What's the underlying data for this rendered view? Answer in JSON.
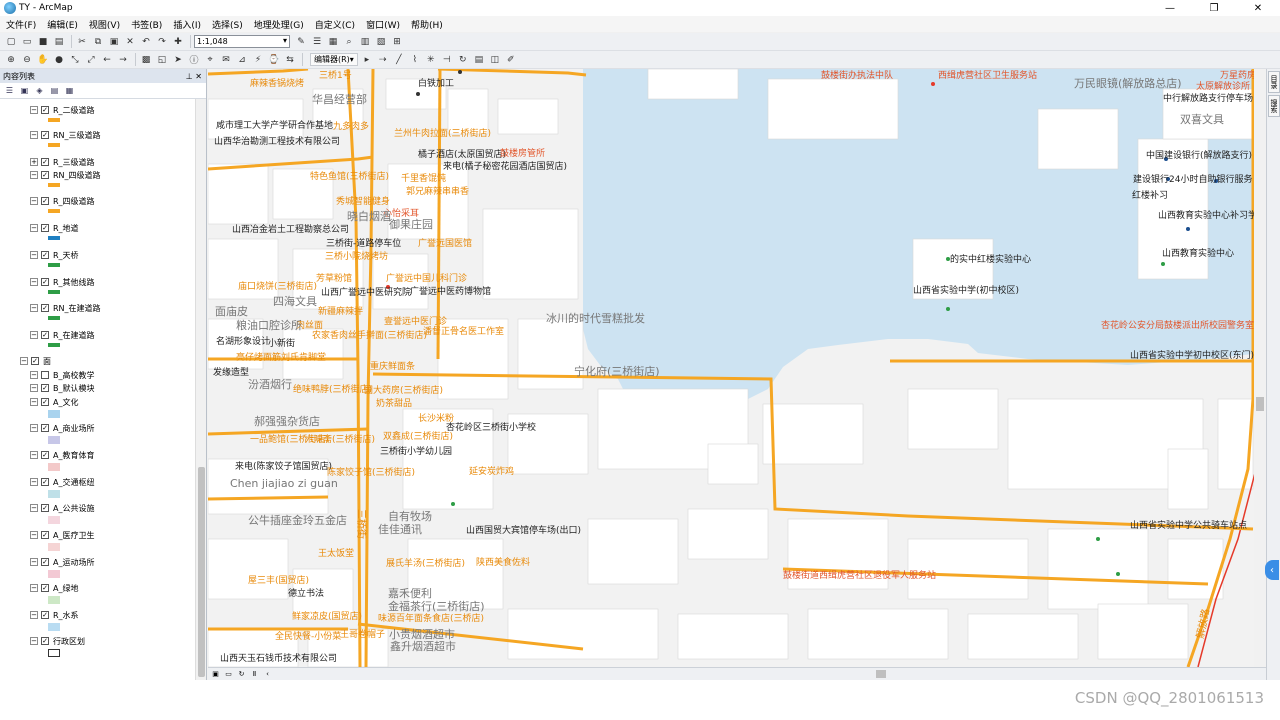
{
  "window": {
    "title": "TY - ArcMap",
    "controls": [
      "—",
      "❐",
      "✕"
    ]
  },
  "menu": [
    "文件(F)",
    "编辑(E)",
    "视图(V)",
    "书签(B)",
    "插入(I)",
    "选择(S)",
    "地理处理(G)",
    "自定义(C)",
    "窗口(W)",
    "帮助(H)"
  ],
  "toolbar": {
    "scale": "1:1,048",
    "editor_label": "编辑器(R)▾"
  },
  "toc": {
    "title": "内容列表",
    "pin": "⊥ ✕",
    "items": [
      {
        "label": "R_二级道路",
        "checked": true,
        "expanded": true,
        "swatch": "#f5a623",
        "type": "line"
      },
      {
        "label": "RN_三级道路",
        "checked": true,
        "expanded": true,
        "swatch": "#f5a623",
        "type": "line"
      },
      {
        "label": "R_三级道路",
        "checked": true,
        "expanded": false,
        "swatch": "",
        "type": "none"
      },
      {
        "label": "RN_四级道路",
        "checked": true,
        "expanded": true,
        "swatch": "#f5a623",
        "type": "line"
      },
      {
        "label": "R_四级道路",
        "checked": true,
        "expanded": true,
        "swatch": "#f5a623",
        "type": "line"
      },
      {
        "label": "R_地道",
        "checked": true,
        "expanded": true,
        "swatch": "#1e7fc2",
        "type": "line"
      },
      {
        "label": "R_天桥",
        "checked": true,
        "expanded": true,
        "swatch": "#2e9d46",
        "type": "line"
      },
      {
        "label": "R_其他线路",
        "checked": true,
        "expanded": true,
        "swatch": "#2e9d46",
        "type": "line"
      },
      {
        "label": "RN_在建道路",
        "checked": true,
        "expanded": true,
        "swatch": "#2e9d46",
        "type": "line"
      },
      {
        "label": "R_在建道路",
        "checked": true,
        "expanded": true,
        "swatch": "#2e9d46",
        "type": "line"
      },
      {
        "label": "面",
        "checked": true,
        "expanded": true,
        "swatch": "",
        "type": "none"
      },
      {
        "label": "B_高校教学",
        "checked": false,
        "expanded": true,
        "swatch": "",
        "type": "none"
      },
      {
        "label": "B_默认模块",
        "checked": true,
        "expanded": true,
        "swatch": "",
        "type": "none"
      },
      {
        "label": "A_文化",
        "checked": true,
        "expanded": true,
        "swatch": "#a9d3ee",
        "type": "box"
      },
      {
        "label": "A_商业场所",
        "checked": true,
        "expanded": true,
        "swatch": "#c7c7e8",
        "type": "box"
      },
      {
        "label": "A_教育体育",
        "checked": true,
        "expanded": true,
        "swatch": "#f3c9c9",
        "type": "box"
      },
      {
        "label": "A_交通枢纽",
        "checked": true,
        "expanded": true,
        "swatch": "#bfe0e8",
        "type": "box"
      },
      {
        "label": "A_公共设施",
        "checked": true,
        "expanded": true,
        "swatch": "#f4d6de",
        "type": "box"
      },
      {
        "label": "A_医疗卫生",
        "checked": true,
        "expanded": true,
        "swatch": "#f5d4d4",
        "type": "box"
      },
      {
        "label": "A_运动场所",
        "checked": true,
        "expanded": true,
        "swatch": "#f3c9d4",
        "type": "box"
      },
      {
        "label": "A_绿地",
        "checked": true,
        "expanded": true,
        "swatch": "#cde8c6",
        "type": "box"
      },
      {
        "label": "R_水系",
        "checked": true,
        "expanded": true,
        "swatch": "#b9dcf2",
        "type": "box"
      },
      {
        "label": "行政区划",
        "checked": true,
        "expanded": true,
        "swatch": "#ffffff",
        "type": "outline"
      }
    ]
  },
  "map_labels": {
    "black": [
      "白铁加工",
      "咸市理工大学产学研合作基地",
      "山西华治勘测工程技术有限公司",
      "橘子酒店(太原国贸店)",
      "来电(橘子秘密花园酒店国贸店)",
      "中国建设银行(解放路支行)",
      "建设银行24小时自助银行服务",
      "红楼补习",
      "山西教育实验中心补习学校",
      "山西教育实验中心",
      "的实中红楼实验中心",
      "山西省实验中学(初中校区)",
      "山西省实验中学初中校区(东门)",
      "三桥街-道路停车位",
      "山西广誉远中医研究院",
      "广誉远中医药博物馆",
      "名湖形象设计",
      "小新街",
      "发缘造型",
      "杏花岭区三桥街小学校",
      "三桥街小学幼儿园",
      "来电(陈家饺子馆国贸店)",
      "山西国贸大宾馆停车场(出口)",
      "山西省实验中学公共骑车站点",
      "德立书法",
      "山西天玉石钱币技术有限公司",
      "中行解放路支行停车场",
      "山西冶金岩土工程勘察总公司"
    ],
    "orange": [
      "三桥1号",
      "麻辣香锅烧烤",
      "九多肉多",
      "兰州牛肉拉面(三桥街店)",
      "特色鱼馆(三桥街店)",
      "千里香馄饨",
      "郭兄麻辣串串香",
      "秀城智能健身",
      "广誉远国医馆",
      "三桥小院烧烤坊",
      "芳草粉馆",
      "庙口烧饼(三桥街店)",
      "新疆麻辣拌",
      "广誉远中国儿科门诊",
      "肉丝面",
      "农家香肉丝手擀面(三桥街店)",
      "壹誉远中医门诊",
      "潘督正骨名医工作室",
      "亮仔烤面筋刘氏肯脚堂",
      "重庆鲜面条",
      "绝味鸭脖(三桥街店)",
      "国大药房(三桥街店)",
      "奶茶甜品",
      "长沙米粉",
      "双鑫成(三桥街店)",
      "一品鲍馆(三桥街店)",
      "六味斋(三桥街店)",
      "陈家饺子馆(三桥街店)",
      "延安炭炸鸡",
      "王太饭堂",
      "展氏羊汤(三桥街店)",
      "陕西美食佐料",
      "屋三丰(国贸店)",
      "鲜家凉皮(国贸店)",
      "味源百年面条食店(三桥店)",
      "全民快餐-小份菜",
      "王哥卷帽子"
    ],
    "red": [
      "鼓楼街办执法中队",
      "西缉虎营社区卫生服务站",
      "太原解放诊所",
      "万星药房",
      "鼓楼房管所",
      "心怡采耳",
      "杏花岭公安分局鼓楼派出所校园警务室",
      "鼓楼街道西缉虎营社区退役军人服务站"
    ],
    "gray": [
      "华昌经营部",
      "晓白烟酒",
      "御果庄园",
      "四海文具",
      "粮油口腔诊所",
      "冰川的时代雪糕批发",
      "宁化府(三桥街店)",
      "汾酒烟行",
      "郝强强杂货店",
      "Chen jiajiao zi guan",
      "公牛插座金玲五金店",
      "自有牧场",
      "佳佳通讯",
      "嘉禾便利",
      "金福茶行(三桥街店)",
      "小贵烟酒超市",
      "鑫升烟酒超市",
      "万民眼镜(解放路总店)",
      "双喜文具",
      "面庙皮"
    ],
    "street": [
      "三桥街",
      "解放路"
    ]
  },
  "status": {
    "watermark": "CSDN @QQ_2801061513"
  },
  "rtabs": [
    "目录",
    "搜索"
  ],
  "colors": {
    "road": "#f5a623",
    "water": "#cde3f2",
    "building": "#ffffff",
    "land": "#f2f2f2",
    "arterial": "#e53a2a"
  }
}
